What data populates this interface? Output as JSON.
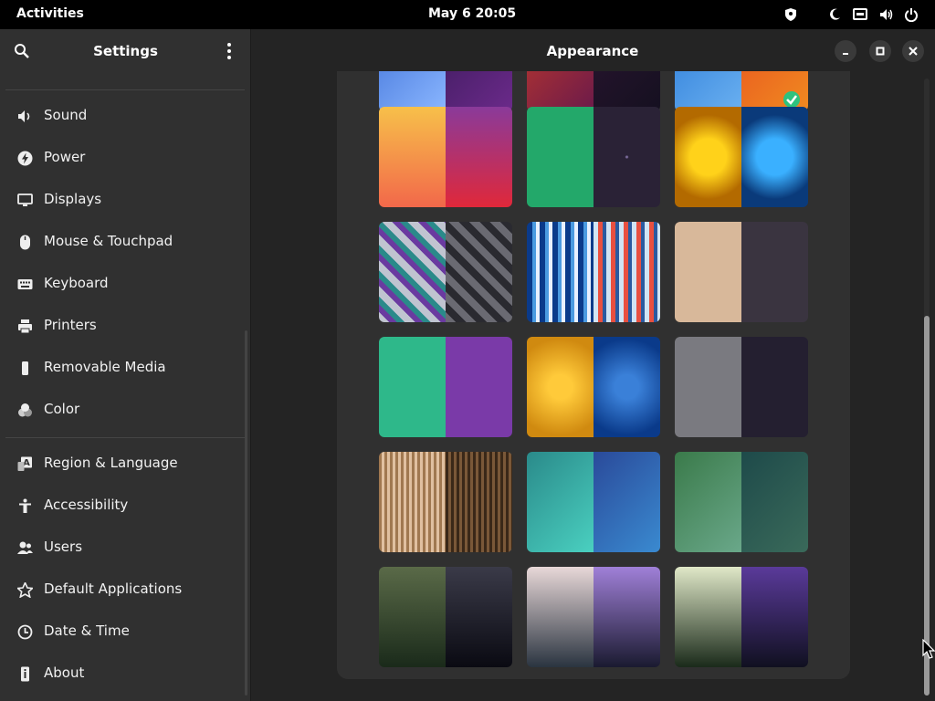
{
  "topbar": {
    "activities": "Activities",
    "clock": "May 6  20:05"
  },
  "sidebar": {
    "title": "Settings",
    "items": [
      {
        "label": "Sound",
        "icon": "speaker-icon"
      },
      {
        "label": "Power",
        "icon": "power-bolt-icon"
      },
      {
        "label": "Displays",
        "icon": "monitor-icon"
      },
      {
        "label": "Mouse & Touchpad",
        "icon": "mouse-icon"
      },
      {
        "label": "Keyboard",
        "icon": "keyboard-icon"
      },
      {
        "label": "Printers",
        "icon": "printer-icon"
      },
      {
        "label": "Removable Media",
        "icon": "usb-drive-icon"
      },
      {
        "label": "Color",
        "icon": "color-circles-icon"
      },
      {
        "label": "Region & Language",
        "icon": "region-language-icon"
      },
      {
        "label": "Accessibility",
        "icon": "accessibility-icon"
      },
      {
        "label": "Users",
        "icon": "users-icon"
      },
      {
        "label": "Default Applications",
        "icon": "star-icon"
      },
      {
        "label": "Date & Time",
        "icon": "clock-icon"
      },
      {
        "label": "About",
        "icon": "info-icon"
      }
    ]
  },
  "content": {
    "title": "Appearance",
    "selected_index": 2,
    "wallpapers": [
      {
        "left": "linear-gradient(135deg,#3d6fd6,#8ab6ff)",
        "right": "linear-gradient(135deg,#3a1a5a,#6b2a8a)"
      },
      {
        "left": "linear-gradient(135deg,#c23a2a,#6b1a4a)",
        "right": "linear-gradient(135deg,#2a1530,#151020)"
      },
      {
        "left": "linear-gradient(135deg,#2a7ad8,#6ab0f0)",
        "right": "linear-gradient(135deg,#e85020,#f08a20)"
      },
      {
        "left": "linear-gradient(180deg,#f7c04a,#f2684a)",
        "right": "linear-gradient(180deg,#8a3a9a,#e0283a)"
      },
      {
        "left": "#23a86a",
        "right": "radial-gradient(circle,#7a6a9a 1px,#2a2236 2px)"
      },
      {
        "left": "radial-gradient(circle,#ffd21a 30%,#b36a00 70%)",
        "right": "radial-gradient(circle,#3ab0ff 30%,#0a3a7a 70%)"
      },
      {
        "left": "repeating-linear-gradient(45deg,#c0c4d0 0 8px,#6a3aa0 8px 14px,#2a8a8a 14px 20px)",
        "right": "repeating-linear-gradient(45deg,#6a6a72 0 8px,#2a2a30 8px 16px)"
      },
      {
        "left": "repeating-linear-gradient(90deg,#0a3a8a 0 6px,#4a9ae0 6px 10px,#e8f0ff 10px 14px)",
        "right": "repeating-linear-gradient(90deg,#d0e4f4 0 5px,#e85040 5px 10px,#2a5aa0 10px 14px)"
      },
      {
        "left": "#d8b89a",
        "right": "#3a3440"
      },
      {
        "left": "#2eb88a",
        "right": "#7a3aa8"
      },
      {
        "left": "radial-gradient(circle,#ffca3a 20%,#d08a10 80%)",
        "right": "radial-gradient(circle,#3a80d8 20%,#0a3a8a 80%)"
      },
      {
        "left": "#7a7a80",
        "right": "#241f30"
      },
      {
        "left": "repeating-linear-gradient(90deg,#a07850 0 3px,#e0c0a0 3px 6px)",
        "right": "repeating-linear-gradient(90deg,#3a2818 0 3px,#7a5838 3px 6px)"
      },
      {
        "left": "linear-gradient(135deg,#2a8a8a,#4ad0c0)",
        "right": "linear-gradient(135deg,#2a4a9a,#3a8ad0)"
      },
      {
        "left": "linear-gradient(135deg,#3a7a4a,#6aa88a)",
        "right": "linear-gradient(135deg,#1e4a4a,#3a6a5a)"
      },
      {
        "left": "linear-gradient(180deg,#5a6a48,#1a2a1a)",
        "right": "linear-gradient(180deg,#3a3a48,#0a0a12)"
      },
      {
        "left": "linear-gradient(180deg,#e8d8d8,#2a3440)",
        "right": "linear-gradient(180deg,#a080d8,#1a1a30)"
      },
      {
        "left": "linear-gradient(180deg,#e0e8c8,#1a2a1a)",
        "right": "linear-gradient(180deg,#5a3a9a,#101020)"
      }
    ]
  }
}
